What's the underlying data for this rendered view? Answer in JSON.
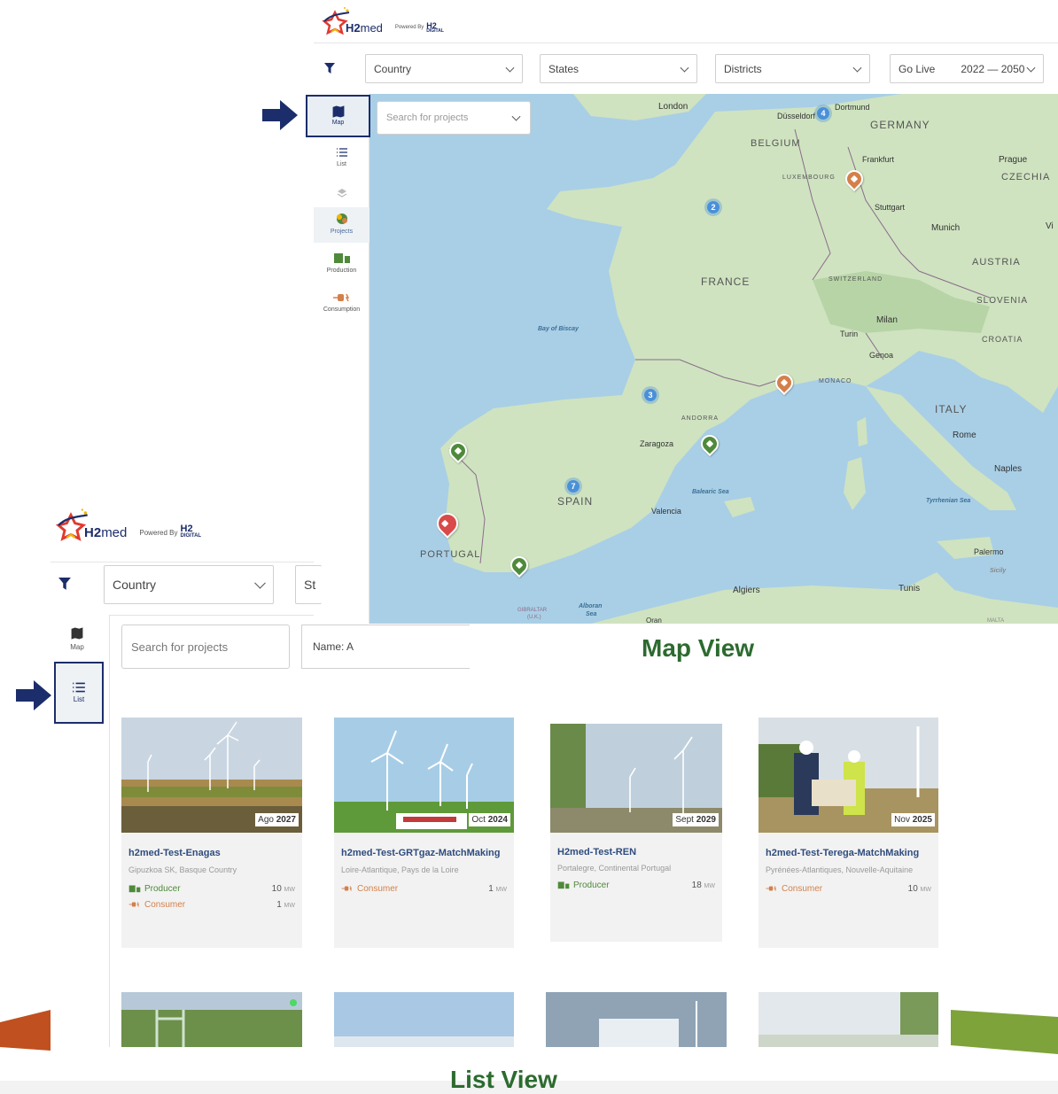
{
  "brand": {
    "name_bold": "H2",
    "name_light": "med",
    "powered_by": "Powered By",
    "partner_top": "H2",
    "partner_bottom": "DIGITAL"
  },
  "map_view": {
    "filters": {
      "country": "Country",
      "states": "States",
      "districts": "Districts",
      "go_live": "Go Live",
      "year_range": "2022 — 2050"
    },
    "search_placeholder": "Search for projects",
    "sidebar": [
      {
        "label": "Map",
        "icon": "map-icon"
      },
      {
        "label": "List",
        "icon": "list-icon"
      },
      {
        "label": "",
        "icon": "layers-icon"
      },
      {
        "label": "Projects",
        "icon": "projects-icon"
      },
      {
        "label": "Production",
        "icon": "production-icon"
      },
      {
        "label": "Consumption",
        "icon": "consumption-icon"
      }
    ],
    "countries": {
      "germany": "GERMANY",
      "belgium": "BELGIUM",
      "czechia": "CZECHIA",
      "france": "FRANCE",
      "austria": "AUSTRIA",
      "slovenia": "SLOVENIA",
      "croatia": "CROATIA",
      "italy": "ITALY",
      "spain": "SPAIN",
      "portugal": "PORTUGAL",
      "andorra": "ANDORRA",
      "switzerland": "SWITZERLAND",
      "monaco": "MONACO",
      "luxembourg": "LUXEMBOURG"
    },
    "cities": {
      "london": "London",
      "dusseldorf": "Düsseldorf",
      "dortmund": "Dortmund",
      "frankfurt": "Frankfurt",
      "prague": "Prague",
      "stuttgart": "Stuttgart",
      "munich": "Munich",
      "vi": "Vi",
      "milan": "Milan",
      "turin": "Turin",
      "genoa": "Genoa",
      "rome": "Rome",
      "naples": "Naples",
      "zaragoza": "Zaragoza",
      "valencia": "Valencia",
      "algiers": "Algiers",
      "tunis": "Tunis",
      "palermo": "Palermo",
      "sicily": "Sicily",
      "oran": "Oran",
      "gibraltar": "GIBRALTAR",
      "gibraltar_uk": "(U.K.)",
      "malta": "MALTA"
    },
    "seas": {
      "biscay": "Bay of Biscay",
      "balearic": "Balearic Sea",
      "tyrrhenian": "Tyrrhenian Sea",
      "alboran": "Alboran",
      "alboran2": "Sea"
    },
    "clusters": [
      "4",
      "2",
      "3",
      "7"
    ],
    "caption": "Map View"
  },
  "list_view": {
    "filters": {
      "country": "Country",
      "states_partial": "St"
    },
    "search_placeholder": "Search for projects",
    "sort": "Name: A",
    "sidebar": [
      {
        "label": "Map",
        "icon": "map-icon"
      },
      {
        "label": "List",
        "icon": "list-icon"
      }
    ],
    "cards": [
      {
        "date_month": "Ago",
        "date_year": "2027",
        "title": "h2med-Test-Enagas",
        "location": "Gipuzkoa SK, Basque Country",
        "rows": [
          {
            "type": "Producer",
            "mw": "10",
            "unit": "MW"
          },
          {
            "type": "Consumer",
            "mw": "1",
            "unit": "MW"
          }
        ]
      },
      {
        "date_month": "Oct",
        "date_year": "2024",
        "title": "h2med-Test-GRTgaz-MatchMaking",
        "location": "Loire-Atlantique, Pays de la Loire",
        "rows": [
          {
            "type": "Consumer",
            "mw": "1",
            "unit": "MW"
          }
        ]
      },
      {
        "date_month": "Sept",
        "date_year": "2029",
        "title": "H2med-Test-REN",
        "location": "Portalegre, Continental Portugal",
        "rows": [
          {
            "type": "Producer",
            "mw": "18",
            "unit": "MW"
          }
        ]
      },
      {
        "date_month": "Nov",
        "date_year": "2025",
        "title": "h2med-Test-Terega-MatchMaking",
        "location": "Pyrénées-Atlantiques, Nouvelle-Aquitaine",
        "rows": [
          {
            "type": "Consumer",
            "mw": "10",
            "unit": "MW"
          }
        ]
      }
    ],
    "caption": "List View"
  },
  "colors": {
    "brand_blue": "#1c2d6b",
    "caption_green": "#2c6b2f",
    "producer": "#4f8a3a",
    "consumer": "#d4804a",
    "card_title": "#2e4c7e"
  }
}
